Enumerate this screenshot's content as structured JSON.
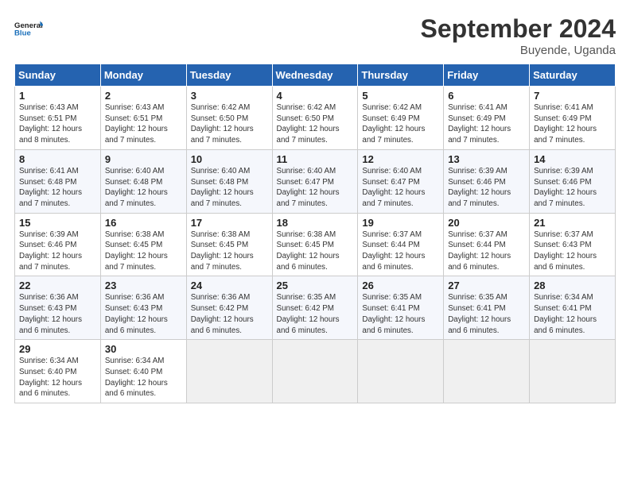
{
  "logo": {
    "line1": "General",
    "line2": "Blue"
  },
  "title": "September 2024",
  "subtitle": "Buyende, Uganda",
  "days_of_week": [
    "Sunday",
    "Monday",
    "Tuesday",
    "Wednesday",
    "Thursday",
    "Friday",
    "Saturday"
  ],
  "weeks": [
    [
      {
        "day": "1",
        "info": "Sunrise: 6:43 AM\nSunset: 6:51 PM\nDaylight: 12 hours\nand 8 minutes."
      },
      {
        "day": "2",
        "info": "Sunrise: 6:43 AM\nSunset: 6:51 PM\nDaylight: 12 hours\nand 7 minutes."
      },
      {
        "day": "3",
        "info": "Sunrise: 6:42 AM\nSunset: 6:50 PM\nDaylight: 12 hours\nand 7 minutes."
      },
      {
        "day": "4",
        "info": "Sunrise: 6:42 AM\nSunset: 6:50 PM\nDaylight: 12 hours\nand 7 minutes."
      },
      {
        "day": "5",
        "info": "Sunrise: 6:42 AM\nSunset: 6:49 PM\nDaylight: 12 hours\nand 7 minutes."
      },
      {
        "day": "6",
        "info": "Sunrise: 6:41 AM\nSunset: 6:49 PM\nDaylight: 12 hours\nand 7 minutes."
      },
      {
        "day": "7",
        "info": "Sunrise: 6:41 AM\nSunset: 6:49 PM\nDaylight: 12 hours\nand 7 minutes."
      }
    ],
    [
      {
        "day": "8",
        "info": "Sunrise: 6:41 AM\nSunset: 6:48 PM\nDaylight: 12 hours\nand 7 minutes."
      },
      {
        "day": "9",
        "info": "Sunrise: 6:40 AM\nSunset: 6:48 PM\nDaylight: 12 hours\nand 7 minutes."
      },
      {
        "day": "10",
        "info": "Sunrise: 6:40 AM\nSunset: 6:48 PM\nDaylight: 12 hours\nand 7 minutes."
      },
      {
        "day": "11",
        "info": "Sunrise: 6:40 AM\nSunset: 6:47 PM\nDaylight: 12 hours\nand 7 minutes."
      },
      {
        "day": "12",
        "info": "Sunrise: 6:40 AM\nSunset: 6:47 PM\nDaylight: 12 hours\nand 7 minutes."
      },
      {
        "day": "13",
        "info": "Sunrise: 6:39 AM\nSunset: 6:46 PM\nDaylight: 12 hours\nand 7 minutes."
      },
      {
        "day": "14",
        "info": "Sunrise: 6:39 AM\nSunset: 6:46 PM\nDaylight: 12 hours\nand 7 minutes."
      }
    ],
    [
      {
        "day": "15",
        "info": "Sunrise: 6:39 AM\nSunset: 6:46 PM\nDaylight: 12 hours\nand 7 minutes."
      },
      {
        "day": "16",
        "info": "Sunrise: 6:38 AM\nSunset: 6:45 PM\nDaylight: 12 hours\nand 7 minutes."
      },
      {
        "day": "17",
        "info": "Sunrise: 6:38 AM\nSunset: 6:45 PM\nDaylight: 12 hours\nand 7 minutes."
      },
      {
        "day": "18",
        "info": "Sunrise: 6:38 AM\nSunset: 6:45 PM\nDaylight: 12 hours\nand 6 minutes."
      },
      {
        "day": "19",
        "info": "Sunrise: 6:37 AM\nSunset: 6:44 PM\nDaylight: 12 hours\nand 6 minutes."
      },
      {
        "day": "20",
        "info": "Sunrise: 6:37 AM\nSunset: 6:44 PM\nDaylight: 12 hours\nand 6 minutes."
      },
      {
        "day": "21",
        "info": "Sunrise: 6:37 AM\nSunset: 6:43 PM\nDaylight: 12 hours\nand 6 minutes."
      }
    ],
    [
      {
        "day": "22",
        "info": "Sunrise: 6:36 AM\nSunset: 6:43 PM\nDaylight: 12 hours\nand 6 minutes."
      },
      {
        "day": "23",
        "info": "Sunrise: 6:36 AM\nSunset: 6:43 PM\nDaylight: 12 hours\nand 6 minutes."
      },
      {
        "day": "24",
        "info": "Sunrise: 6:36 AM\nSunset: 6:42 PM\nDaylight: 12 hours\nand 6 minutes."
      },
      {
        "day": "25",
        "info": "Sunrise: 6:35 AM\nSunset: 6:42 PM\nDaylight: 12 hours\nand 6 minutes."
      },
      {
        "day": "26",
        "info": "Sunrise: 6:35 AM\nSunset: 6:41 PM\nDaylight: 12 hours\nand 6 minutes."
      },
      {
        "day": "27",
        "info": "Sunrise: 6:35 AM\nSunset: 6:41 PM\nDaylight: 12 hours\nand 6 minutes."
      },
      {
        "day": "28",
        "info": "Sunrise: 6:34 AM\nSunset: 6:41 PM\nDaylight: 12 hours\nand 6 minutes."
      }
    ],
    [
      {
        "day": "29",
        "info": "Sunrise: 6:34 AM\nSunset: 6:40 PM\nDaylight: 12 hours\nand 6 minutes."
      },
      {
        "day": "30",
        "info": "Sunrise: 6:34 AM\nSunset: 6:40 PM\nDaylight: 12 hours\nand 6 minutes."
      },
      {
        "day": "",
        "info": ""
      },
      {
        "day": "",
        "info": ""
      },
      {
        "day": "",
        "info": ""
      },
      {
        "day": "",
        "info": ""
      },
      {
        "day": "",
        "info": ""
      }
    ]
  ]
}
